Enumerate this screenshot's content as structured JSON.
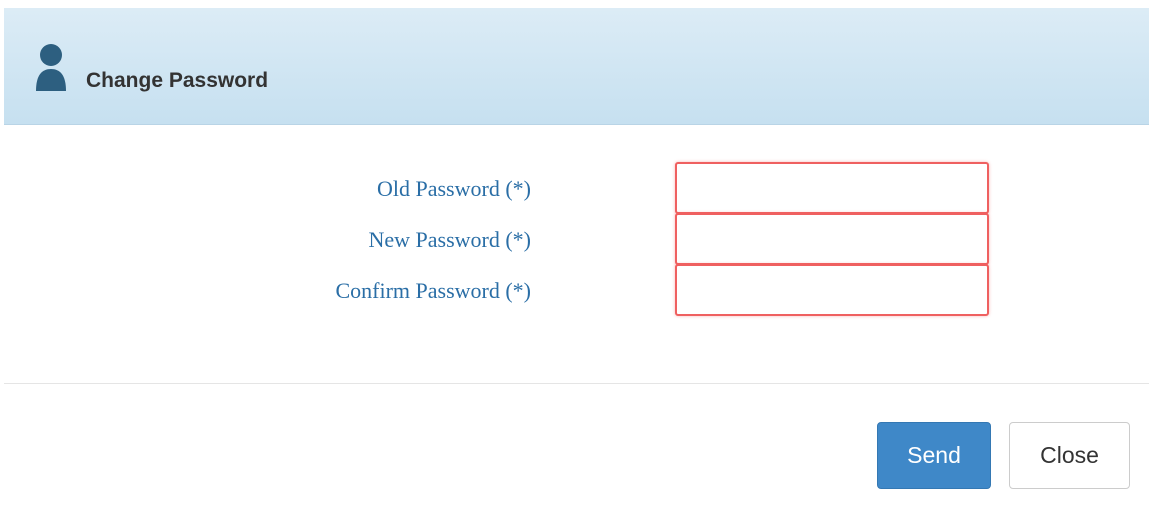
{
  "dialog": {
    "title": "Change Password",
    "icon": "user-icon",
    "accent_color": "#2a6ea6"
  },
  "form": {
    "fields": [
      {
        "label": "Old Password (*)",
        "value": "",
        "invalid": true
      },
      {
        "label": "New Password (*)",
        "value": "",
        "invalid": true
      },
      {
        "label": "Confirm Password (*)",
        "value": "",
        "invalid": true
      }
    ],
    "invalid_border_color": "#ef6060"
  },
  "footer": {
    "send_label": "Send",
    "close_label": "Close",
    "send_color": "#3f88c8"
  }
}
